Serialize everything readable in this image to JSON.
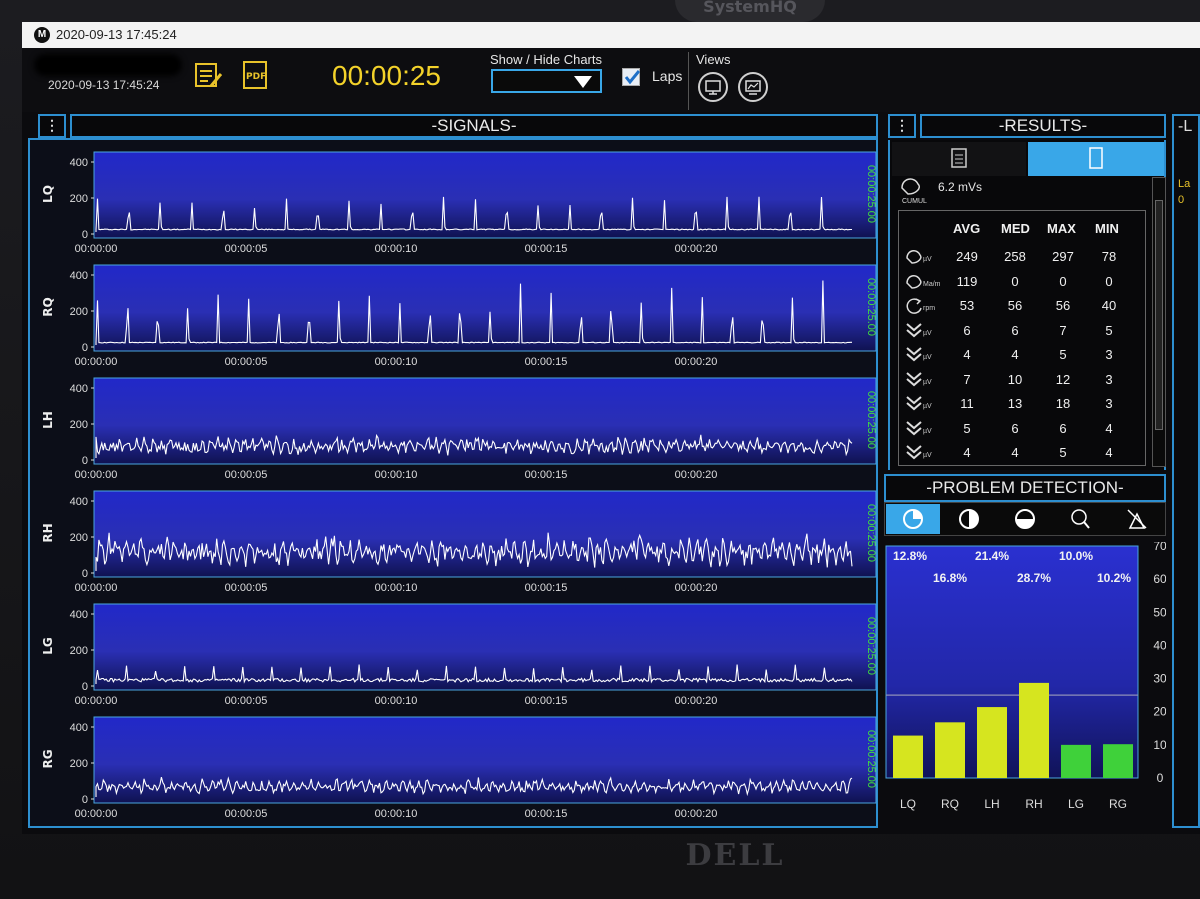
{
  "titlebar": {
    "title": "2020-09-13 17:45:24"
  },
  "toolbar": {
    "session_datetime": "2020-09-13 17:45:24",
    "timer": "00:00:25",
    "show_hide_label": "Show / Hide Charts",
    "laps_label": "Laps",
    "laps_checked": true,
    "views_label": "Views"
  },
  "bezel": {
    "brand": "DELL",
    "top_logo": "SystemHQ"
  },
  "signals": {
    "title": "-SIGNALS-",
    "end_time": "00:00:25.00",
    "y_ticks": [
      "400",
      "200",
      "0"
    ],
    "x_ticks": [
      "00:00:00",
      "00:00:05",
      "00:00:10",
      "00:00:15",
      "00:00:20"
    ],
    "channels": [
      {
        "name": "LQ",
        "amplitude": 0.55,
        "spikes": 24,
        "noise": 0.05
      },
      {
        "name": "RQ",
        "amplitude": 0.85,
        "spikes": 25,
        "noise": 0.04
      },
      {
        "name": "LH",
        "amplitude": 0.25,
        "spikes": 0,
        "noise": 0.55
      },
      {
        "name": "RH",
        "amplitude": 0.45,
        "spikes": 0,
        "noise": 0.9
      },
      {
        "name": "LG",
        "amplitude": 0.28,
        "spikes": 26,
        "noise": 0.2
      },
      {
        "name": "RG",
        "amplitude": 0.25,
        "spikes": 0,
        "noise": 0.35
      }
    ]
  },
  "results": {
    "title": "-RESULTS-",
    "cumul_value": "6.2 mVs",
    "cumul_label": "CUMUL",
    "headers": [
      "AVG",
      "MED",
      "MAX",
      "MIN"
    ],
    "rows": [
      {
        "icon": "muscle-icon",
        "unit": "µV",
        "values": [
          "249",
          "258",
          "297",
          "78"
        ]
      },
      {
        "icon": "muscle-icon",
        "unit": "Ma/m",
        "values": [
          "119",
          "0",
          "0",
          "0"
        ]
      },
      {
        "icon": "rotate-icon",
        "unit": "rpm",
        "values": [
          "53",
          "56",
          "56",
          "40"
        ]
      },
      {
        "icon": "double-chevron-icon",
        "unit": "µV",
        "values": [
          "6",
          "6",
          "7",
          "5"
        ]
      },
      {
        "icon": "double-chevron-icon",
        "unit": "µV",
        "values": [
          "4",
          "4",
          "5",
          "3"
        ]
      },
      {
        "icon": "double-chevron-icon",
        "unit": "µV",
        "values": [
          "7",
          "10",
          "12",
          "3"
        ]
      },
      {
        "icon": "double-chevron-icon",
        "unit": "µV",
        "values": [
          "11",
          "13",
          "18",
          "3"
        ]
      },
      {
        "icon": "double-chevron-icon",
        "unit": "µV",
        "values": [
          "5",
          "6",
          "6",
          "4"
        ]
      },
      {
        "icon": "double-chevron-icon",
        "unit": "µV",
        "values": [
          "4",
          "4",
          "5",
          "4"
        ]
      }
    ]
  },
  "problem_detection": {
    "title": "-PROBLEM DETECTION-",
    "tabs": [
      "pie-icon",
      "contrast-icon",
      "half-circle-icon",
      "search-warning-icon",
      "no-signal-icon"
    ]
  },
  "side_panel": {
    "title": "-L",
    "text": "La",
    "value": "0"
  },
  "chart_data": {
    "type": "bar",
    "categories": [
      "LQ",
      "RQ",
      "LH",
      "RH",
      "LG",
      "RG"
    ],
    "values": [
      12.8,
      16.8,
      21.4,
      28.7,
      10.0,
      10.2
    ],
    "labels": [
      "12.8%",
      "16.8%",
      "21.4%",
      "28.7%",
      "10.0%",
      "10.2%"
    ],
    "colors": [
      "#d6e51f",
      "#d6e51f",
      "#d6e51f",
      "#d6e51f",
      "#3fd13a",
      "#3fd13a"
    ],
    "ylim": [
      0,
      70
    ],
    "yticks": [
      "0",
      "10",
      "20",
      "30",
      "40",
      "50",
      "60",
      "70"
    ],
    "threshold": 25,
    "grid": false
  }
}
